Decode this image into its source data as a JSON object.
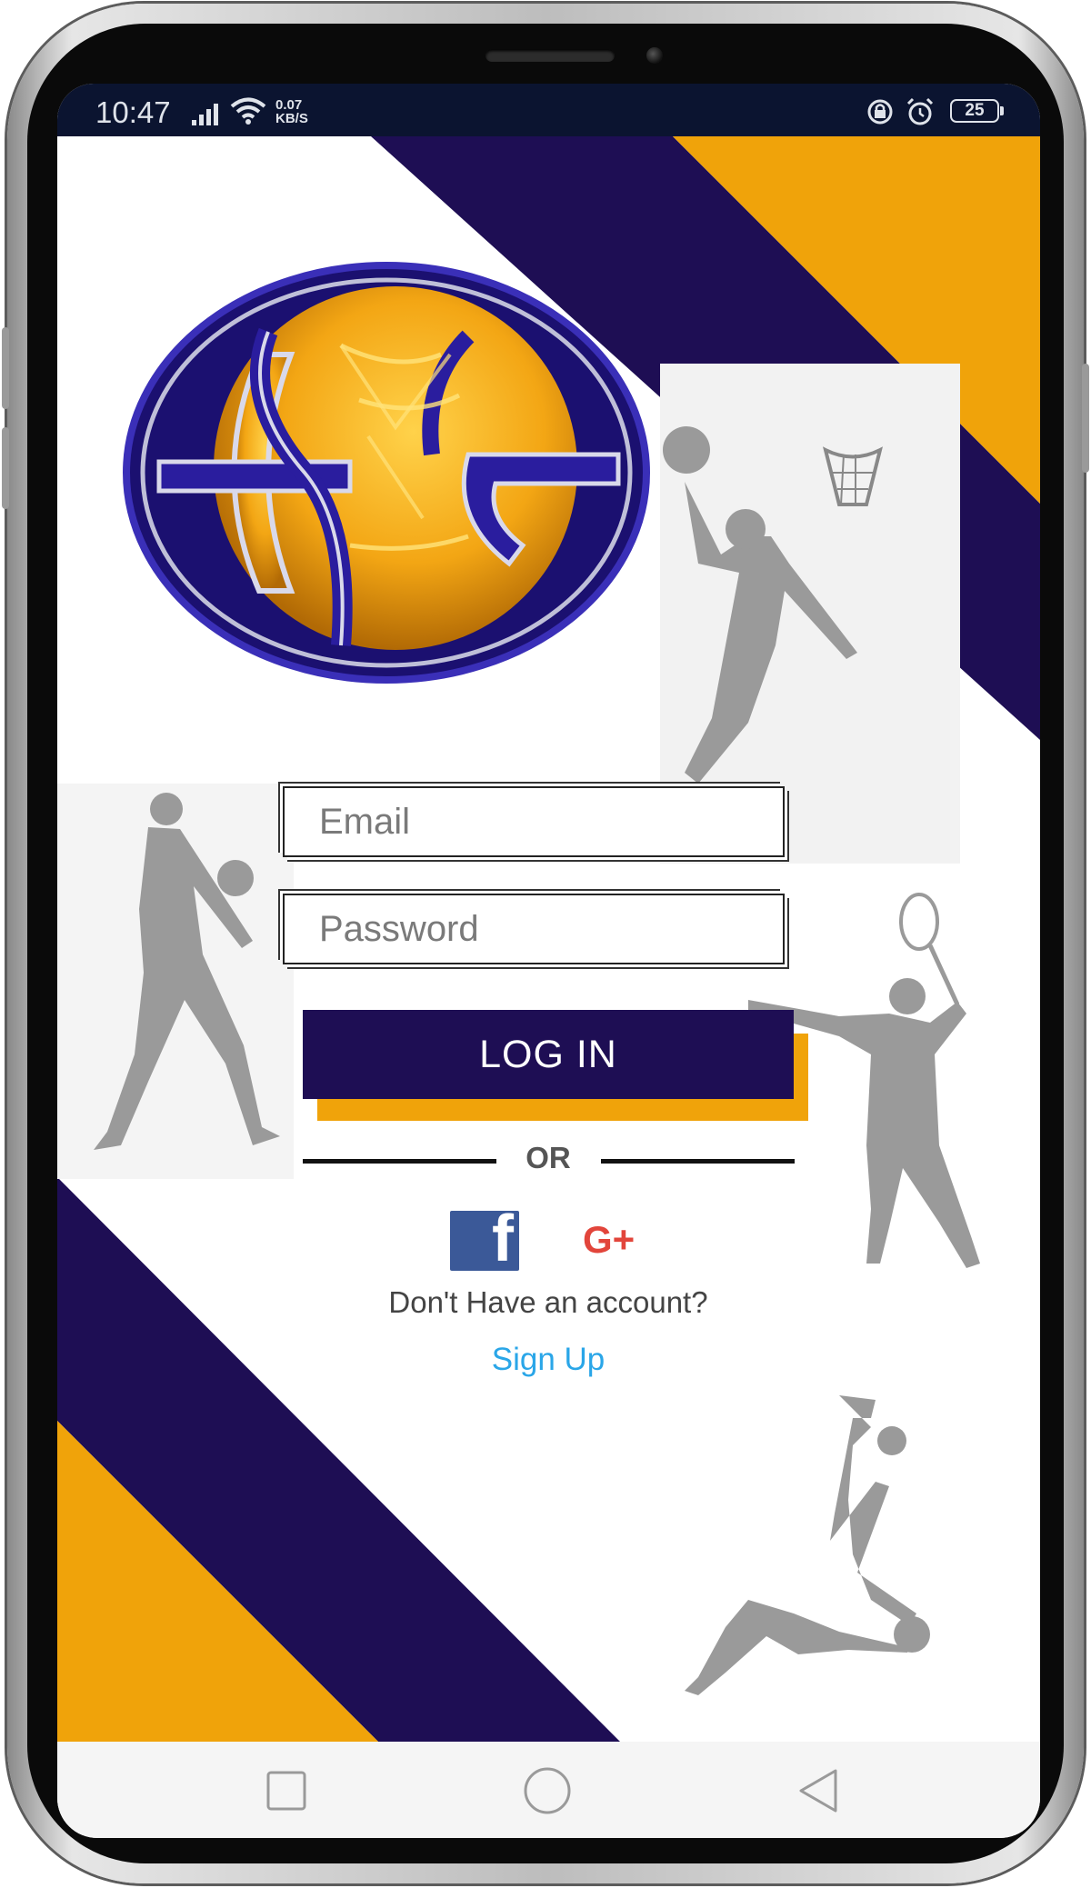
{
  "status_bar": {
    "time": "10:47",
    "net_speed_value": "0.07",
    "net_speed_unit": "KB/S",
    "battery": "25",
    "icons": [
      "signal-icon",
      "wifi-icon",
      "lock-rotation-icon",
      "alarm-icon",
      "battery-icon"
    ]
  },
  "colors": {
    "navy": "#1e0e54",
    "gold": "#f0a30a",
    "link": "#2aa6e8",
    "facebook": "#3b5998",
    "google": "#e2453b"
  },
  "login": {
    "email_placeholder": "Email",
    "password_placeholder": "Password",
    "login_label": "LOG IN",
    "or_label": "OR",
    "google_label": "G+",
    "facebook_label": "f",
    "account_prompt": "Don't Have an account?",
    "signup_label": "Sign Up"
  },
  "nav_bar": {
    "items": [
      "recent-apps-icon",
      "home-icon",
      "back-icon"
    ]
  }
}
